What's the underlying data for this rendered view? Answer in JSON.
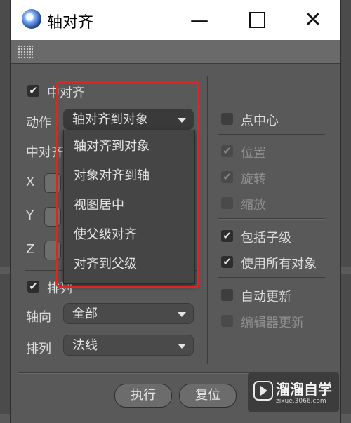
{
  "window": {
    "title": "轴对齐",
    "minimize_glyph": "—",
    "close_glyph": "✕"
  },
  "left": {
    "center_align_label": "中对齐",
    "action_label": "动作",
    "action_value": "轴对齐到对象",
    "center_align_sub_label": "中对齐",
    "axis_x": "X",
    "axis_y": "Y",
    "axis_z": "Z",
    "arrange_label": "排列",
    "axis_dir_label": "轴向",
    "axis_dir_value": "全部",
    "arrange_row_label": "排列",
    "arrange_value": "法线"
  },
  "dropdown": {
    "items": [
      "轴对齐到对象",
      "对象对齐到轴",
      "视图居中",
      "使父级对齐",
      "对齐到父级"
    ]
  },
  "right": {
    "point_center": "点中心",
    "position": "位置",
    "rotation": "旋转",
    "scale": "缩放",
    "include_children": "包括子级",
    "use_all_objects": "使用所有对象",
    "auto_update": "自动更新",
    "editor_update": "编辑器更新"
  },
  "buttons": {
    "execute": "执行",
    "reset": "复位"
  },
  "watermark": {
    "brand": "溜溜自学",
    "url": "zixue.3066.com"
  },
  "colors": {
    "highlight_border": "#e02424",
    "panel": "#595959"
  }
}
